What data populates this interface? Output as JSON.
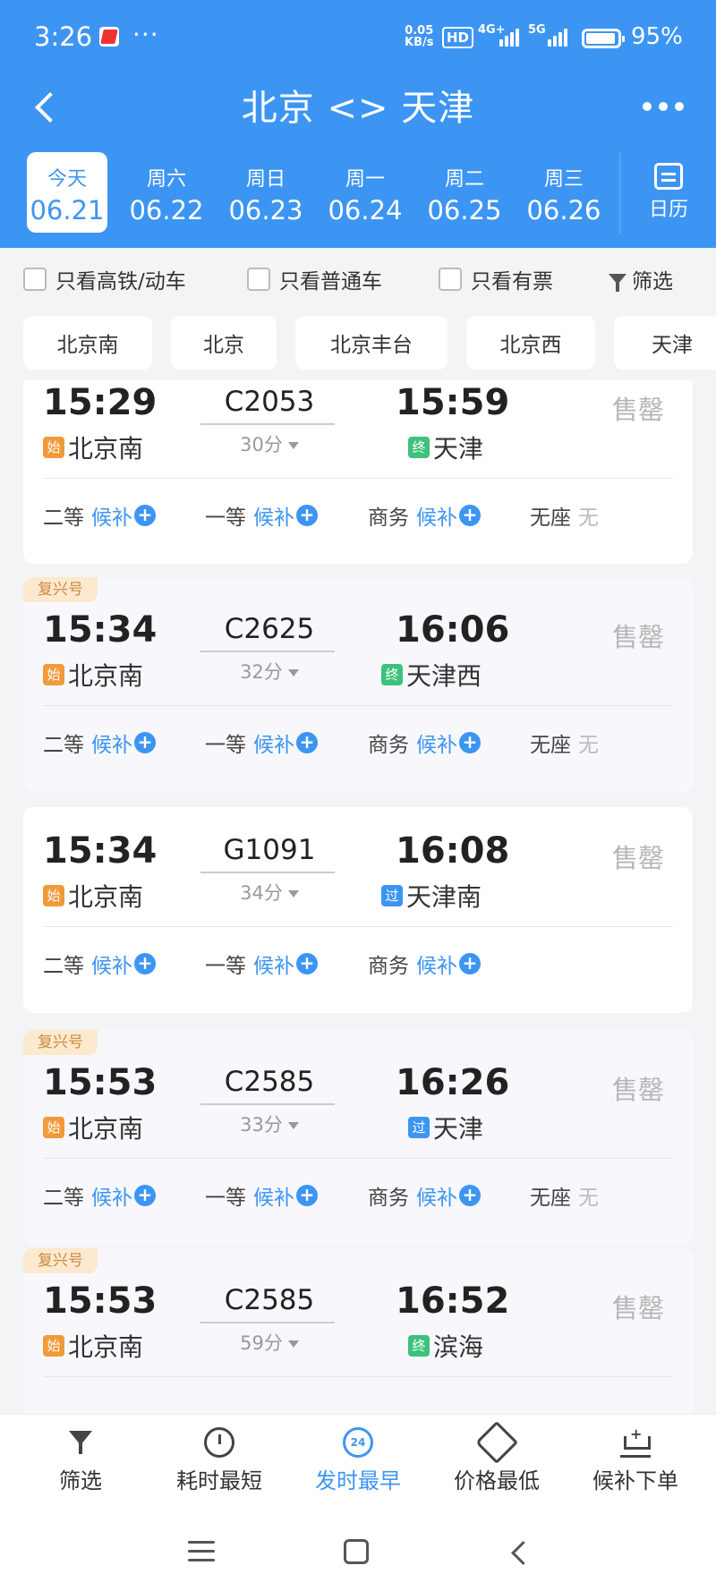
{
  "status_bar": {
    "time": "3:26",
    "net_speed_value": "0.05",
    "net_speed_unit": "KB/s",
    "hd": "HD",
    "net1": "4G+",
    "net2": "5G",
    "battery": "95%"
  },
  "header": {
    "title": "北京 <> 天津"
  },
  "dates": [
    {
      "weekday": "今天",
      "date": "06.21",
      "active": true
    },
    {
      "weekday": "周六",
      "date": "06.22"
    },
    {
      "weekday": "周日",
      "date": "06.23"
    },
    {
      "weekday": "周一",
      "date": "06.24"
    },
    {
      "weekday": "周二",
      "date": "06.25"
    },
    {
      "weekday": "周三",
      "date": "06.26"
    }
  ],
  "calendar_label": "日历",
  "filters": {
    "high_speed": "只看高铁/动车",
    "normal": "只看普通车",
    "available": "只看有票",
    "filter": "筛选"
  },
  "stations": [
    "北京南",
    "北京",
    "北京丰台",
    "北京西",
    "天津"
  ],
  "trains": [
    {
      "badge": "",
      "dep_time": "15:29",
      "dep_tag": "始",
      "dep_station": "北京南",
      "train_no": "C2053",
      "duration": "30分",
      "arr_time": "15:59",
      "arr_tag": "终",
      "arr_station": "天津",
      "status": "售罄",
      "seats": [
        {
          "name": "二等",
          "state": "候补"
        },
        {
          "name": "一等",
          "state": "候补"
        },
        {
          "name": "商务",
          "state": "候补"
        },
        {
          "name": "无座",
          "state": "无"
        }
      ]
    },
    {
      "badge": "复兴号",
      "dep_time": "15:34",
      "dep_tag": "始",
      "dep_station": "北京南",
      "train_no": "C2625",
      "duration": "32分",
      "arr_time": "16:06",
      "arr_tag": "终",
      "arr_station": "天津西",
      "status": "售罄",
      "seats": [
        {
          "name": "二等",
          "state": "候补"
        },
        {
          "name": "一等",
          "state": "候补"
        },
        {
          "name": "商务",
          "state": "候补"
        },
        {
          "name": "无座",
          "state": "无"
        }
      ]
    },
    {
      "badge": "",
      "dep_time": "15:34",
      "dep_tag": "始",
      "dep_station": "北京南",
      "train_no": "G1091",
      "duration": "34分",
      "arr_time": "16:08",
      "arr_tag": "过",
      "arr_station": "天津南",
      "status": "售罄",
      "seats": [
        {
          "name": "二等",
          "state": "候补"
        },
        {
          "name": "一等",
          "state": "候补"
        },
        {
          "name": "商务",
          "state": "候补"
        }
      ]
    },
    {
      "badge": "复兴号",
      "dep_time": "15:53",
      "dep_tag": "始",
      "dep_station": "北京南",
      "train_no": "C2585",
      "duration": "33分",
      "arr_time": "16:26",
      "arr_tag": "过",
      "arr_station": "天津",
      "status": "售罄",
      "seats": [
        {
          "name": "二等",
          "state": "候补"
        },
        {
          "name": "一等",
          "state": "候补"
        },
        {
          "name": "商务",
          "state": "候补"
        },
        {
          "name": "无座",
          "state": "无"
        }
      ]
    },
    {
      "badge": "复兴号",
      "dep_time": "15:53",
      "dep_tag": "始",
      "dep_station": "北京南",
      "train_no": "C2585",
      "duration": "59分",
      "arr_time": "16:52",
      "arr_tag": "终",
      "arr_station": "滨海",
      "status": "售罄",
      "seats": []
    }
  ],
  "bottom_tabs": [
    {
      "label": "筛选",
      "icon": "funnel-icon"
    },
    {
      "label": "耗时最短",
      "icon": "clock-icon"
    },
    {
      "label": "发时最早",
      "icon": "24h-icon",
      "icon_text": "24",
      "active": true
    },
    {
      "label": "价格最低",
      "icon": "price-tag-icon"
    },
    {
      "label": "候补下单",
      "icon": "cart-icon"
    }
  ],
  "colors": {
    "primary": "#3d95f3",
    "badge_bg": "#fde9cf",
    "badge_text": "#c98a3e",
    "start_tag": "#f19a3a",
    "end_tag": "#3dc17c",
    "pass_tag": "#3d95f3"
  }
}
